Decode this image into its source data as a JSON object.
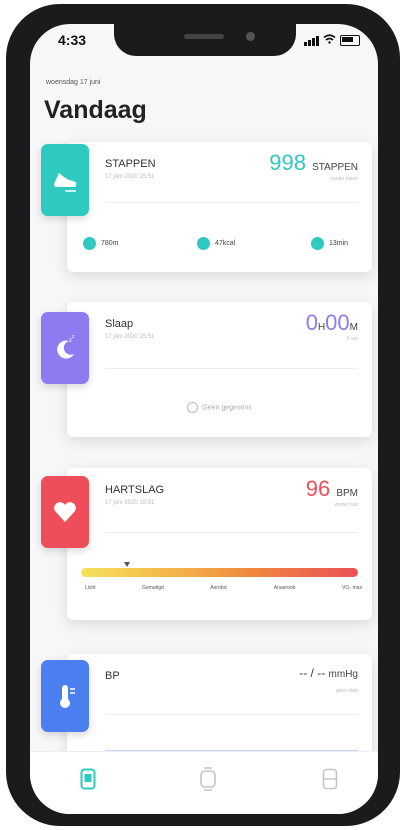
{
  "status": {
    "time": "4:33"
  },
  "header": {
    "date": "woensdag 17 juni",
    "title": "Vandaag"
  },
  "cards": {
    "steps": {
      "name": "STAPPEN",
      "time": "17 juni 2020 15:51",
      "value": "998",
      "unit": "STAPPEN",
      "sub": "verder lopen",
      "stats": [
        {
          "label": "780m"
        },
        {
          "label": "47kcal"
        },
        {
          "label": "13min"
        }
      ]
    },
    "sleep": {
      "name": "Slaap",
      "time": "17 juni 2020 15:51",
      "hours": "0",
      "hours_unit": "H",
      "minutes": "00",
      "minutes_unit": "M",
      "sub": "0 uur",
      "link": "Geen gegevens"
    },
    "heart": {
      "name": "HARTSLAG",
      "time": "17 juni 2020 15:51",
      "value": "96",
      "unit": "BPM",
      "sub": "verder rust",
      "zones": [
        "Licht",
        "Gematigd",
        "Aerobic",
        "Anaeroob",
        "VO₂ max"
      ]
    },
    "bp": {
      "name": "BP",
      "time": "",
      "value": "-- / --",
      "unit": "mmHg",
      "sub": "geen data"
    }
  },
  "colors": {
    "steps": "#2ec9c0",
    "sleep": "#8c7bf1",
    "heart": "#ee4d5a",
    "bp": "#4b7ff0"
  }
}
